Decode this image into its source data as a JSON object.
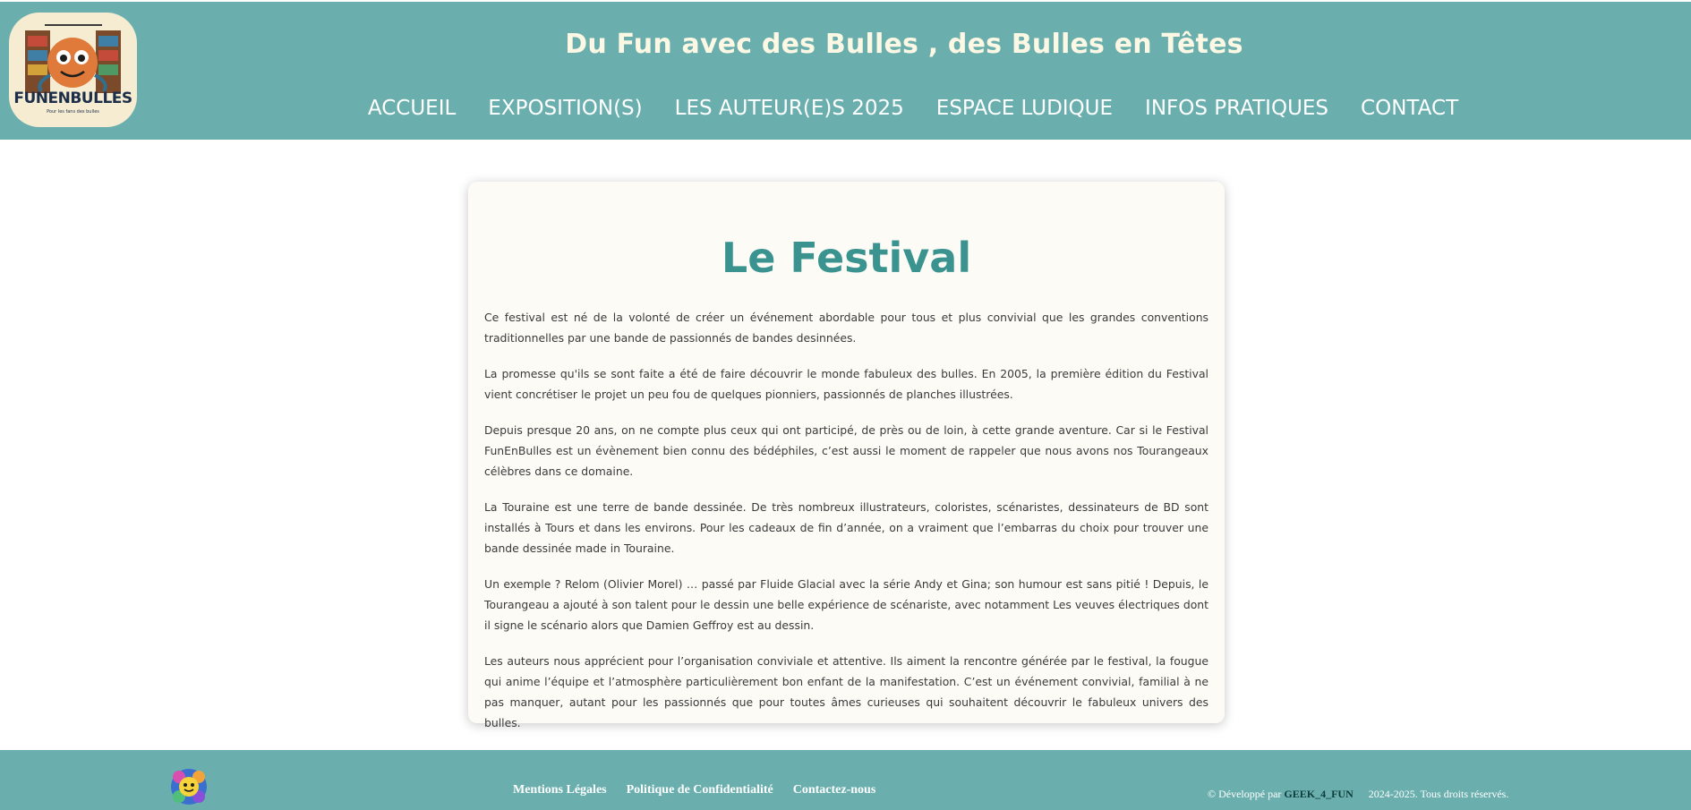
{
  "header": {
    "logo_text": "FUNENBULLES",
    "logo_tagline": "Pour les fans des bulles",
    "site_title": "Du Fun avec des Bulles , des Bulles en Têtes",
    "nav": [
      "ACCUEIL",
      "EXPOSITION(S)",
      "LES AUTEUR(E)S 2025",
      "ESPACE LUDIQUE",
      "INFOS PRATIQUES",
      "CONTACT"
    ]
  },
  "main": {
    "title": "Le Festival",
    "paragraphs": [
      "Ce festival est né de la volonté de créer un événement abordable pour tous et plus convivial que les grandes conventions traditionnelles par une bande de passionnés de bandes desinnées.",
      "La promesse qu'ils se sont faite a été de faire découvrir le monde fabuleux des bulles. En 2005, la première édition du Festival vient concrétiser le projet un peu fou de quelques pionniers, passionnés de planches illustrées.",
      "Depuis presque 20 ans, on ne compte plus ceux qui ont participé, de près ou de loin, à cette grande aventure. Car si le Festival FunEnBulles est un évènement bien connu des bédéphiles, c’est aussi le moment de rappeler que nous avons nos Tourangeaux célèbres dans ce domaine.",
      "La Touraine est une terre de bande dessinée. De très nombreux illustrateurs, coloristes, scénaristes, dessinateurs de BD sont installés à Tours et dans les environs. Pour les cadeaux de fin d’année, on a vraiment que l’embarras du choix pour trouver une bande dessinée made in Touraine.",
      "Un exemple ? Relom (Olivier Morel) … passé par Fluide Glacial avec la série Andy et Gina; son humour est sans pitié ! Depuis, le Tourangeau a ajouté à son talent pour le dessin une belle expérience de scénariste, avec notamment Les veuves électriques dont il signe le scénario alors que Damien Geffroy est au dessin.",
      "Les auteurs nous apprécient pour l’organisation conviviale et attentive. Ils aiment la rencontre générée par le festival, la fougue qui anime l’équipe et l’atmosphère particulièrement bon enfant de la manifestation. C’est un événement convivial, familial à ne pas manquer, autant pour les passionnés que pour toutes âmes curieuses qui souhaitent découvrir le fabuleux univers des bulles."
    ]
  },
  "footer": {
    "links": [
      "Mentions Légales",
      "Politique de Confidentialité",
      "Contactez-nous"
    ],
    "credit_prefix": "© Développé par",
    "credit_brand": "GEEK_4_FUN",
    "rights": "2024-2025. Tous droits réservés."
  },
  "colors": {
    "header_bg": "#6aafae",
    "title_color": "#3b9390",
    "card_bg": "#fdfbf6",
    "brand_dark": "#0d3d3b"
  },
  "icons": {
    "logo": "funenbulles-mascot-logo",
    "footer_logo": "geek-4-fun-mascot-logo"
  }
}
